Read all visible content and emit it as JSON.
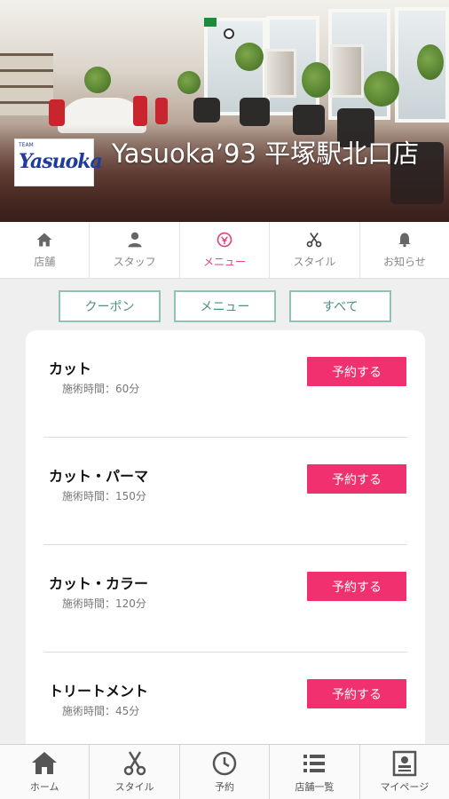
{
  "header": {
    "shop_title": "Yasuoka’93 平塚駅北口店",
    "logo_small_text": "TEAM",
    "logo_mark": "Yasuoka"
  },
  "top_tabs": [
    {
      "label": "店舗",
      "icon": "home-icon",
      "active": false
    },
    {
      "label": "スタッフ",
      "icon": "person-icon",
      "active": false
    },
    {
      "label": "メニュー",
      "icon": "menu-icon",
      "active": true
    },
    {
      "label": "スタイル",
      "icon": "scissors-icon",
      "active": false
    },
    {
      "label": "お知らせ",
      "icon": "bell-icon",
      "active": false
    }
  ],
  "filters": [
    {
      "label": "クーポン"
    },
    {
      "label": "メニュー"
    },
    {
      "label": "すべて"
    }
  ],
  "menu_items": [
    {
      "name": "カット",
      "time": "施術時間：60分",
      "button": "予約する"
    },
    {
      "name": "カット・パーマ",
      "time": "施術時間：150分",
      "button": "予約する"
    },
    {
      "name": "カット・カラー",
      "time": "施術時間：120分",
      "button": "予約する"
    },
    {
      "name": "トリートメント",
      "time": "施術時間：45分",
      "button": "予約する"
    }
  ],
  "bottom_nav": [
    {
      "label": "ホーム",
      "icon": "home-icon"
    },
    {
      "label": "スタイル",
      "icon": "scissors-icon"
    },
    {
      "label": "予約",
      "icon": "clock-icon"
    },
    {
      "label": "店舗一覧",
      "icon": "list-icon"
    },
    {
      "label": "マイページ",
      "icon": "id-card-icon"
    }
  ],
  "colors": {
    "accent_pink": "#f0306f",
    "active_tab": "#e0467b",
    "filter_border": "#8fc3b8"
  }
}
